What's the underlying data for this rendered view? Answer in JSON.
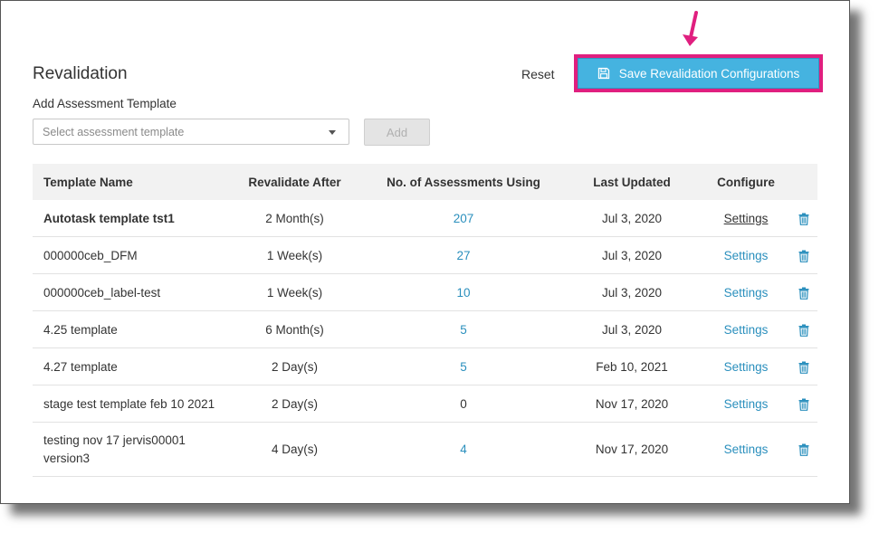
{
  "header": {
    "title": "Revalidation",
    "reset_label": "Reset",
    "save_label": "Save Revalidation Configurations"
  },
  "add_section": {
    "label": "Add Assessment Template",
    "select_placeholder": "Select assessment template",
    "add_label": "Add"
  },
  "table": {
    "columns": [
      "Template Name",
      "Revalidate After",
      "No. of Assessments Using",
      "Last Updated",
      "Configure"
    ],
    "rows": [
      {
        "name": "Autotask template tst1",
        "revalidate": "2 Month(s)",
        "count": "207",
        "updated": "Jul 3, 2020",
        "configure": "Settings"
      },
      {
        "name": "000000ceb_DFM",
        "revalidate": "1 Week(s)",
        "count": "27",
        "updated": "Jul 3, 2020",
        "configure": "Settings"
      },
      {
        "name": "000000ceb_label-test",
        "revalidate": "1 Week(s)",
        "count": "10",
        "updated": "Jul 3, 2020",
        "configure": "Settings"
      },
      {
        "name": "4.25 template",
        "revalidate": "6 Month(s)",
        "count": "5",
        "updated": "Jul 3, 2020",
        "configure": "Settings"
      },
      {
        "name": "4.27 template",
        "revalidate": "2 Day(s)",
        "count": "5",
        "updated": "Feb 10, 2021",
        "configure": "Settings"
      },
      {
        "name": "stage test template feb 10 2021",
        "revalidate": "2 Day(s)",
        "count": "0",
        "updated": "Nov 17, 2020",
        "configure": "Settings"
      },
      {
        "name": "testing nov 17 jervis00001 version3",
        "revalidate": "4 Day(s)",
        "count": "4",
        "updated": "Nov 17, 2020",
        "configure": "Settings"
      }
    ]
  },
  "colors": {
    "accent": "#45b3e0",
    "highlight": "#e01f7f",
    "link": "#2a8fbd"
  },
  "icons": {
    "save": "floppy-disk-icon",
    "delete": "trash-icon",
    "dropdown": "caret-down-icon",
    "annotation": "arrow-down-icon"
  }
}
